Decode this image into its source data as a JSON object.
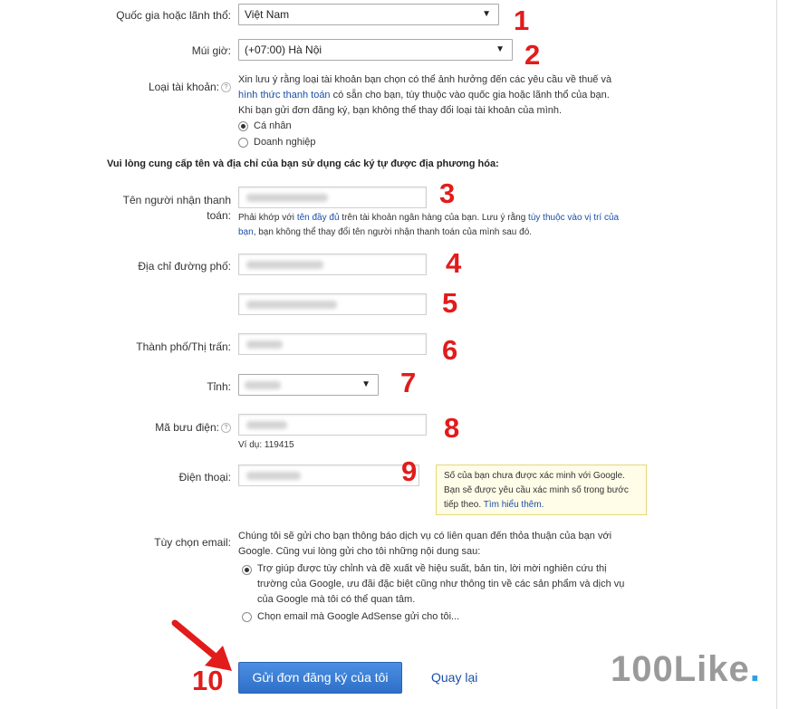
{
  "form": {
    "country": {
      "label": "Quốc gia hoặc lãnh thổ:",
      "value": "Việt Nam"
    },
    "timezone": {
      "label": "Múi giờ:",
      "value": "(+07:00) Hà Nội"
    },
    "account_type": {
      "label": "Loại tài khoản:",
      "note_part1": "Xin lưu ý rằng loại tài khoản bạn chọn có thể ảnh hưởng đến các yêu cầu về thuế và",
      "note_link": "hình thức thanh toán",
      "note_part2": " có sẵn cho bạn, tùy thuộc vào quốc gia hoặc lãnh thổ của bạn.",
      "note_part3": "Khi bạn gửi đơn đăng ký, bạn không thể thay đổi loại tài khoản của mình.",
      "options": [
        "Cá nhân",
        "Doanh nghiệp"
      ],
      "selected": "Cá nhân"
    },
    "section_heading": "Vui lòng cung cấp tên và địa chỉ của bạn sử dụng các ký tự được địa phương hóa:",
    "payee_name": {
      "label_line1": "Tên người nhận thanh",
      "label_line2": "toán:",
      "hint_part1": "Phải khớp với ",
      "hint_link1": "tên đầy đủ",
      "hint_part2": " trên tài khoản ngân hàng của bạn. Lưu ý rằng ",
      "hint_link2": "tùy thuộc vào vị trí của",
      "hint_link3": "bạn",
      "hint_part3": ", bạn không thể thay đổi tên người nhận thanh toán của mình sau đó."
    },
    "street": {
      "label": "Địa chỉ đường phố:"
    },
    "city": {
      "label": "Thành phố/Thị trấn:"
    },
    "province": {
      "label": "Tỉnh:"
    },
    "postal": {
      "label": "Mã bưu điện:",
      "example": "Ví dụ: 119415"
    },
    "phone": {
      "label": "Điện thoại:",
      "tooltip_line1": "Số của bạn chưa được xác minh với Google.",
      "tooltip_line2": "Bạn sẽ được yêu cầu xác minh số trong bước",
      "tooltip_line3": "tiếp theo. ",
      "tooltip_link": "Tìm hiểu thêm."
    },
    "email_options": {
      "label": "Tùy chọn email:",
      "intro_line1": "Chúng tôi sẽ gửi cho bạn thông báo dịch vụ có liên quan đến thỏa thuận của bạn với",
      "intro_line2": "Google. Cũng vui lòng gửi cho tôi những nội dung sau:",
      "option1_line1": "Trợ giúp được tùy chỉnh và đề xuất về hiệu suất, bản tin, lời mời nghiên cứu thị",
      "option1_line2": "trường của Google, ưu đãi đặc biệt cũng như thông tin về các sản phẩm và dịch vụ",
      "option1_line3": "của Google mà tôi có thể quan tâm.",
      "option2": "Chọn email mà Google AdSense gửi cho tôi..."
    },
    "submit_label": "Gửi đơn đăng ký của tôi",
    "back_label": "Quay lại"
  },
  "annotations": {
    "step_numbers": [
      "1",
      "2",
      "3",
      "4",
      "5",
      "6",
      "7",
      "8",
      "9",
      "10"
    ],
    "color": "#e21b1b"
  },
  "brand": {
    "text": "100Like",
    "dot": "."
  },
  "colors": {
    "link": "#1a4fa8",
    "button": "#3a7fd5",
    "tooltip_bg": "#fffce8"
  }
}
